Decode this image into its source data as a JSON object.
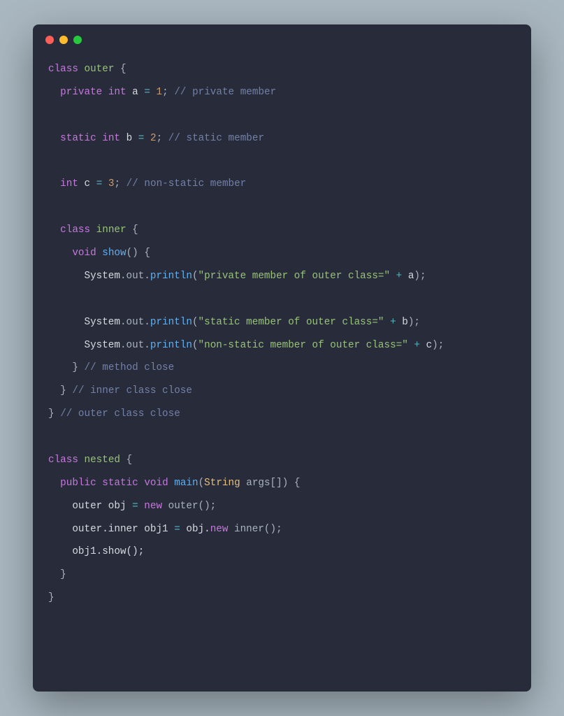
{
  "code": {
    "l1_class": "class",
    "l1_outer": "outer",
    "l1_brace": " {",
    "l2_private": "private",
    "l2_int": "int",
    "l2_a": "a",
    "l2_eq": "=",
    "l2_1": "1",
    "l2_semi": ";",
    "l2_cmt": "// private member",
    "l3_static": "static",
    "l3_int": "int",
    "l3_b": "b",
    "l3_eq": "=",
    "l3_2": "2",
    "l3_semi": ";",
    "l3_cmt": "// static member",
    "l4_int": "int",
    "l4_c": "c",
    "l4_eq": "=",
    "l4_3": "3",
    "l4_semi": ";",
    "l4_cmt": "// non-static member",
    "l5_class": "class",
    "l5_inner": "inner",
    "l5_brace": " {",
    "l6_void": "void",
    "l6_show": "show",
    "l6_paren": "() {",
    "l7_sys": "System",
    "l7_out": ".out.",
    "l7_println": "println",
    "l7_open": "(",
    "l7_str": "\"private member of outer class=\"",
    "l7_plus": " + ",
    "l7_a": "a",
    "l7_close": ");",
    "l8_sys": "System",
    "l8_out": ".out.",
    "l8_println": "println",
    "l8_open": "(",
    "l8_str": "\"static member of outer class=\"",
    "l8_plus": " + ",
    "l8_b": "b",
    "l8_close": ");",
    "l9_sys": "System",
    "l9_out": ".out.",
    "l9_println": "println",
    "l9_open": "(",
    "l9_str": "\"non-static member of outer class=\"",
    "l9_plus": " + ",
    "l9_c": "c",
    "l9_close": ");",
    "l10_brace": "}",
    "l10_cmt": "// method close",
    "l11_brace": "}",
    "l11_cmt": "// inner class close",
    "l12_brace": "}",
    "l12_cmt": "// outer class close",
    "l13_class": "class",
    "l13_nested": "nested",
    "l13_brace": " {",
    "l14_public": "public",
    "l14_static": "static",
    "l14_void": "void",
    "l14_main": "main",
    "l14_open": "(",
    "l14_string": "String",
    "l14_args": " args[]) {",
    "l15_outer": "outer obj ",
    "l15_eq": "=",
    "l15_new": " new",
    "l15_call": " outer();",
    "l16_outer": "outer.inner obj1 ",
    "l16_eq": "=",
    "l16_objnew": " obj.",
    "l16_new": "new",
    "l16_call": " inner();",
    "l17_call": "obj1.show();",
    "l18_brace": "}",
    "l19_brace": "}"
  }
}
